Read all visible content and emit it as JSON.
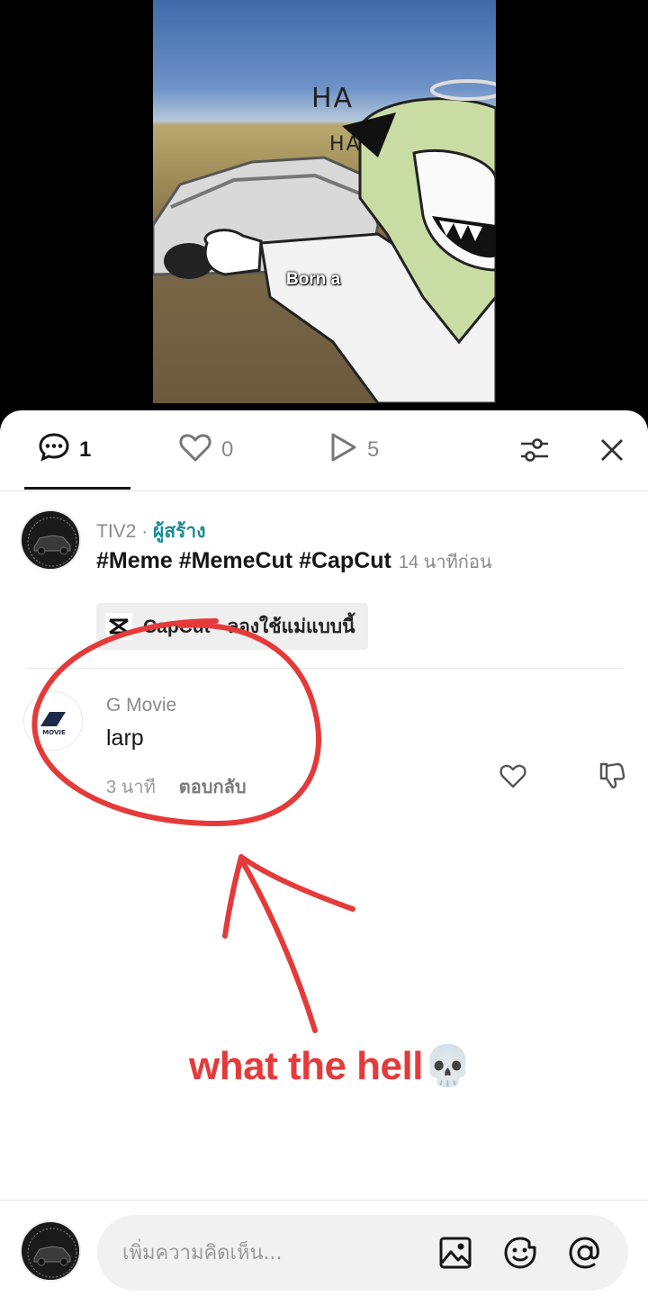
{
  "video": {
    "overlay_text_1": "HA",
    "overlay_text_2": "HA",
    "caption": "Born a"
  },
  "tabs": [
    {
      "name": "comments",
      "icon": "comment-icon",
      "count": "1",
      "active": true
    },
    {
      "name": "likes",
      "icon": "heart-icon",
      "count": "0",
      "active": false
    },
    {
      "name": "plays",
      "icon": "play-icon",
      "count": "5",
      "active": false
    }
  ],
  "header_actions": {
    "filter_icon": "sliders-icon",
    "close_icon": "close-icon"
  },
  "creator_comment": {
    "author": "TIV2",
    "separator": " · ",
    "creator_tag": "ผู้สร้าง",
    "text": "#Meme #MemeCut #CapCut",
    "time": "14 นาทีก่อน",
    "template_chip": "CapCut · ลองใช้แม่แบบนี้"
  },
  "reply_comment": {
    "author": "G Movie",
    "avatar_text": "MOVIE",
    "text": "larp",
    "time": "3 นาที",
    "reply_label": "ตอบกลับ"
  },
  "annotation": {
    "text": "what the hell💀",
    "color": "#e53a3a"
  },
  "composer": {
    "placeholder": "เพิ่มความคิดเห็น...",
    "icons": [
      "image-icon",
      "emoji-icon",
      "mention-icon"
    ]
  }
}
